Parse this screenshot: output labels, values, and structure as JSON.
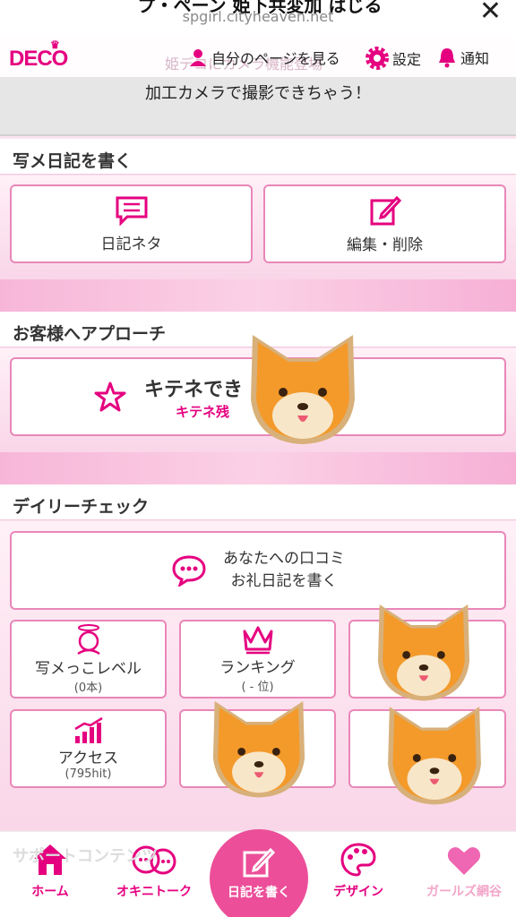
{
  "browser": {
    "title": "プ・ペーン 姫下共変加 はじる",
    "url": "spgirl.cityheaven.net",
    "close_icon": "close-icon"
  },
  "header": {
    "logo": "DECO",
    "my_page": "自分のページを見る",
    "settings": "設定",
    "notifications": "通知",
    "marquee_ghost": "姫デコにカメラ機能登場"
  },
  "notice": {
    "text": "加工カメラで撮影できちゃう！"
  },
  "diary_section": {
    "title": "写メ日記を書く",
    "diary_topic": "日記ネタ",
    "edit_delete": "編集・削除"
  },
  "approach_section": {
    "title": "お客様へアプローチ",
    "kitene_label": "キテネでき",
    "kitene_sub": "キテネ残"
  },
  "daily_section": {
    "title": "デイリーチェック",
    "review_line1": "あなたへの口コミ",
    "review_line2": "お礼日記を書く",
    "photo_level": "写メっこレベル",
    "photo_level_value": "(0本)",
    "ranking": "ランキング",
    "ranking_value": "( - 位)",
    "access": "アクセス",
    "access_value": "(795hit)"
  },
  "support_ghost": "サポートコンテンツ",
  "footer": {
    "home": "ホーム",
    "okini_talk": "オキニトーク",
    "write_diary": "日記を書く",
    "design": "デザイン",
    "girls_hint": "ガールズ網谷"
  },
  "colors": {
    "accent": "#e5007f",
    "card_border": "#e987b8",
    "center_button": "#ec4e99",
    "dog_orange": "#f39a2b"
  }
}
